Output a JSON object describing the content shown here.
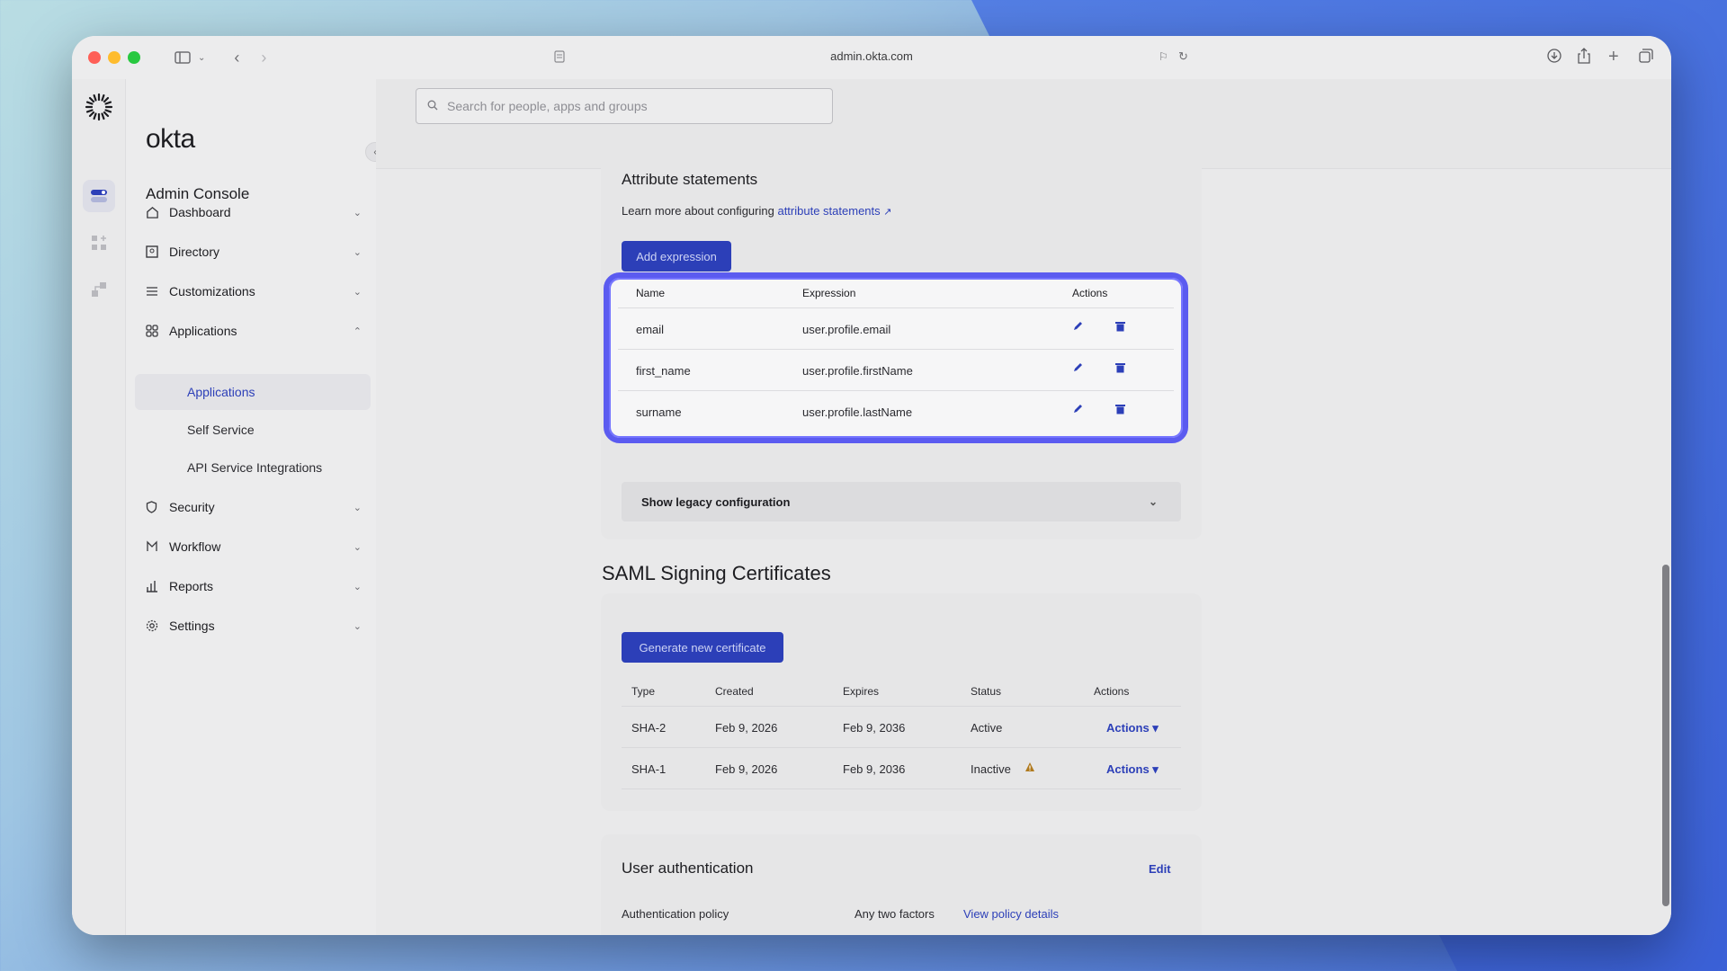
{
  "browser": {
    "url": "admin.okta.com"
  },
  "sidebar": {
    "logo": "okta",
    "console_title": "Admin Console",
    "items": [
      {
        "label": "Dashboard",
        "icon": "home-icon"
      },
      {
        "label": "Directory",
        "icon": "directory-icon"
      },
      {
        "label": "Customizations",
        "icon": "sliders-icon"
      },
      {
        "label": "Applications",
        "icon": "apps-icon"
      },
      {
        "label": "Security",
        "icon": "shield-icon"
      },
      {
        "label": "Workflow",
        "icon": "workflow-icon"
      },
      {
        "label": "Reports",
        "icon": "reports-icon"
      },
      {
        "label": "Settings",
        "icon": "gear-icon"
      }
    ],
    "sub_items": [
      {
        "label": "Applications",
        "active": true
      },
      {
        "label": "Self Service",
        "active": false
      },
      {
        "label": "API Service Integrations",
        "active": false
      }
    ]
  },
  "search": {
    "placeholder": "Search for people, apps and groups"
  },
  "attribute_statements": {
    "title": "Attribute statements",
    "help_prefix": "Learn more about configuring",
    "help_link": "attribute statements",
    "add_button": "Add expression",
    "columns": [
      "Name",
      "Expression",
      "Actions"
    ],
    "rows": [
      {
        "name": "email",
        "expression": "user.profile.email"
      },
      {
        "name": "first_name",
        "expression": "user.profile.firstName"
      },
      {
        "name": "surname",
        "expression": "user.profile.lastName"
      }
    ],
    "legacy_toggle": "Show legacy configuration"
  },
  "certificates": {
    "title": "SAML Signing Certificates",
    "generate_button": "Generate new certificate",
    "columns": [
      "Type",
      "Created",
      "Expires",
      "Status",
      "Actions"
    ],
    "rows": [
      {
        "type": "SHA-2",
        "created": "Feb 9, 2026",
        "expires": "Feb 9, 2036",
        "status": "Active",
        "actions": "Actions ▾"
      },
      {
        "type": "SHA-1",
        "created": "Feb 9, 2026",
        "expires": "Feb 9, 2036",
        "status": "Inactive",
        "actions": "Actions ▾"
      }
    ]
  },
  "user_auth": {
    "title": "User authentication",
    "edit": "Edit",
    "policy_label": "Authentication policy",
    "policy_value": "Any two factors",
    "policy_link": "View policy details"
  },
  "colors": {
    "accent": "#2c3fb8",
    "highlight": "#5b5bf0",
    "warning": "#b07a1e"
  }
}
